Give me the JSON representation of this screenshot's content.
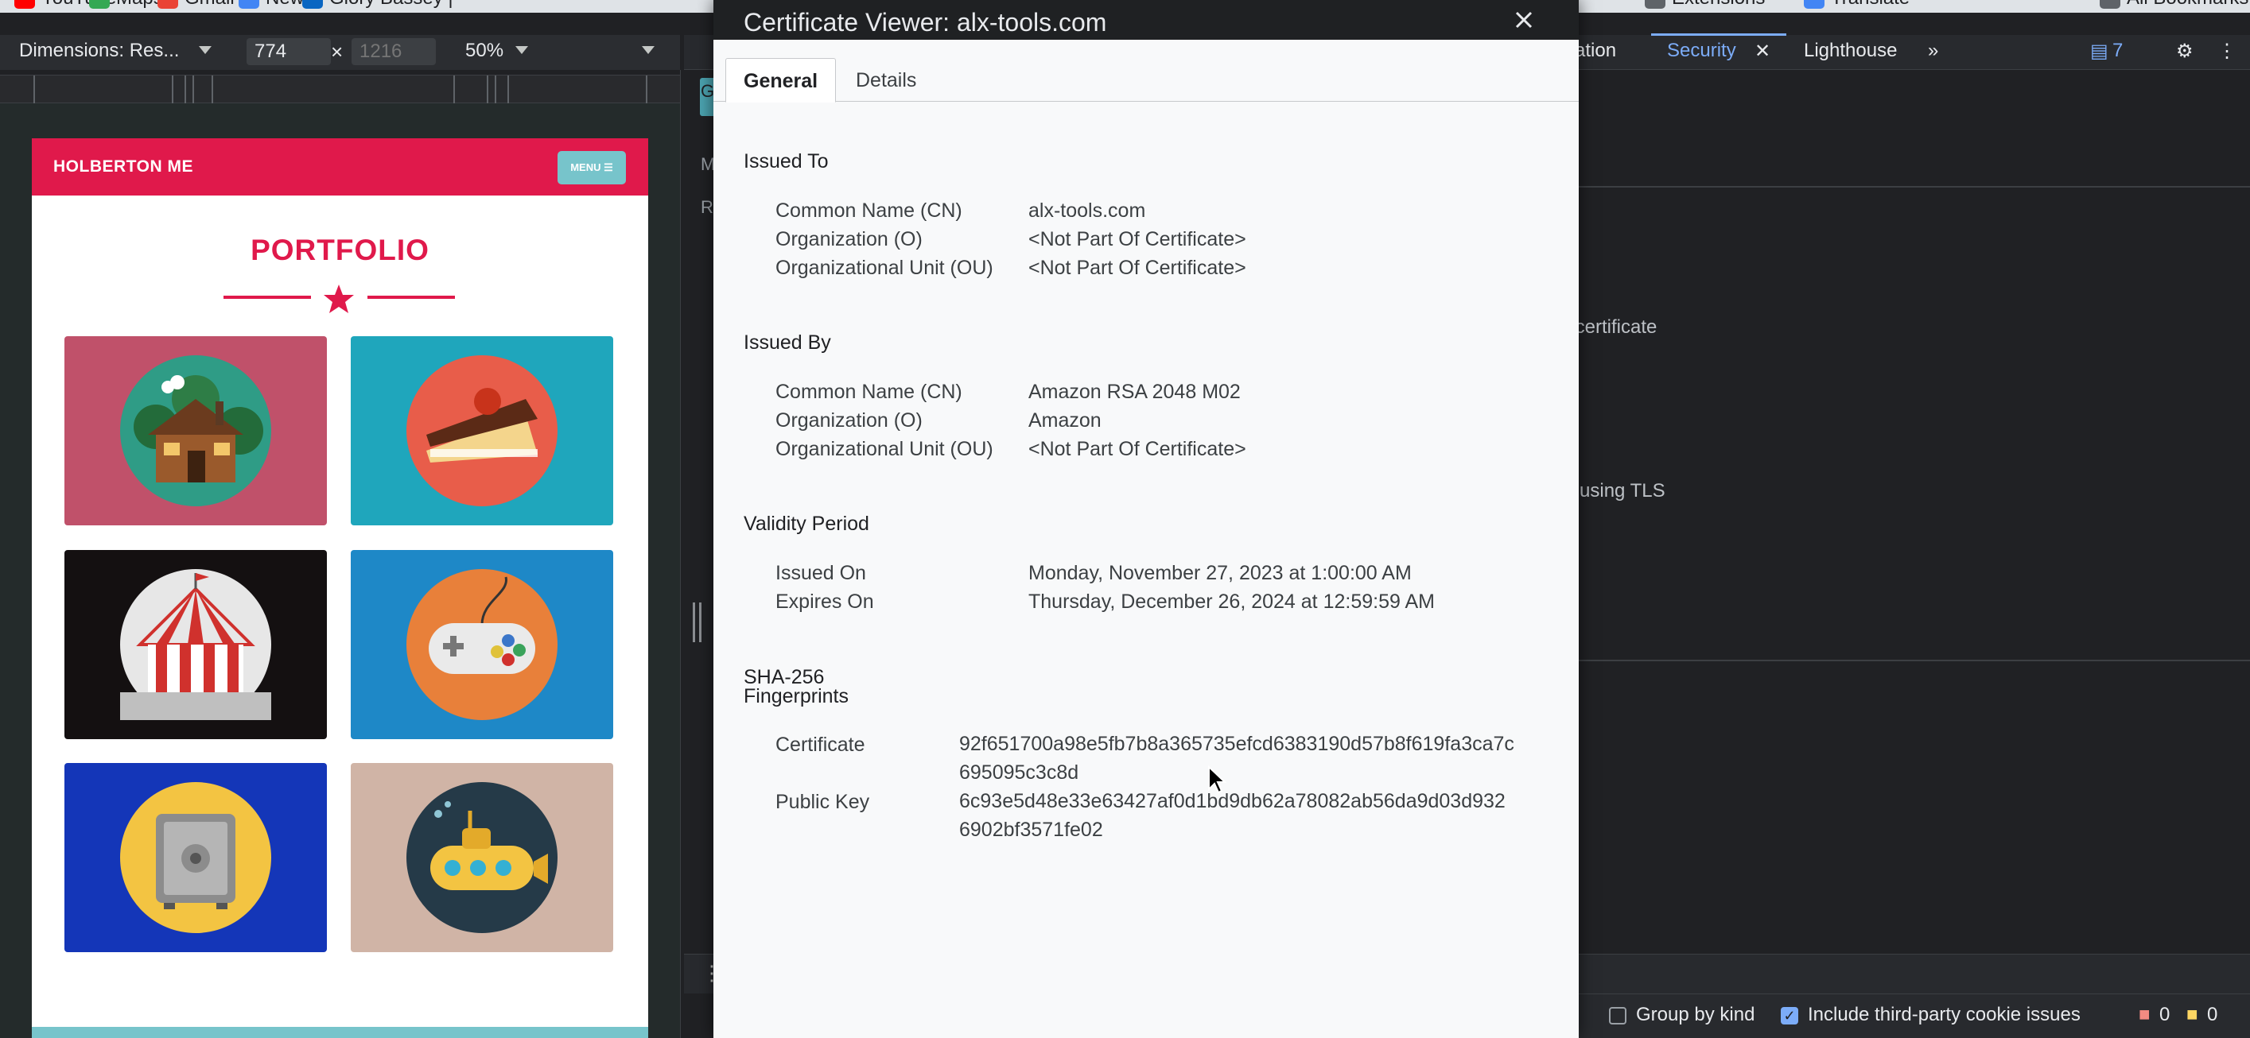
{
  "bookmarks": [
    {
      "label": "YouTube",
      "color": "#ff0000"
    },
    {
      "label": "Maps",
      "color": "#34a853"
    },
    {
      "label": "Gmail",
      "color": "#ea4335"
    },
    {
      "label": "News",
      "color": "#4285f4"
    },
    {
      "label": "Glory Bassey |",
      "color": "#0a66c2"
    },
    {
      "label": "Extensions",
      "color": "#5f6368"
    },
    {
      "label": "Translate",
      "color": "#4285f4"
    },
    {
      "label": "All Bookmarks",
      "color": "#5f6368"
    }
  ],
  "device_toolbar": {
    "dimensions_label": "Dimensions: Res...",
    "width_value": "774",
    "height_placeholder": "1216",
    "times": "×",
    "zoom": "50%"
  },
  "website": {
    "brand": "HOLBERTON ME",
    "menu_label": "MENU ☰",
    "title": "PORTFOLIO",
    "cards": [
      {
        "name": "cabin",
        "bg": "#c0516a"
      },
      {
        "name": "cake",
        "bg": "#1fa6bc"
      },
      {
        "name": "circus",
        "bg": "#141011"
      },
      {
        "name": "gamepad",
        "bg": "#1e88c7"
      },
      {
        "name": "safe",
        "bg": "#1436b8"
      },
      {
        "name": "submarine",
        "bg": "#d0b4a6"
      }
    ],
    "accent": "#e0194b"
  },
  "devtools": {
    "tabs": [
      "cation",
      "Security",
      "Lighthouse"
    ],
    "overflow": "»",
    "issues_count": "7",
    "security_fragments": [
      "r certificate",
      "d using TLS"
    ],
    "left_fragments": [
      "G",
      "M",
      "R"
    ],
    "issues_bar": {
      "group_by_kind": "Group by kind",
      "third_party": "Include third-party cookie issues",
      "errors": "0",
      "warnings": "0"
    }
  },
  "certificate": {
    "title": "Certificate Viewer: alx-tools.com",
    "tabs": [
      "General",
      "Details"
    ],
    "issued_to": {
      "heading": "Issued To",
      "rows": [
        {
          "label": "Common Name (CN)",
          "value": "alx-tools.com"
        },
        {
          "label": "Organization (O)",
          "value": "<Not Part Of Certificate>"
        },
        {
          "label": "Organizational Unit (OU)",
          "value": "<Not Part Of Certificate>"
        }
      ]
    },
    "issued_by": {
      "heading": "Issued By",
      "rows": [
        {
          "label": "Common Name (CN)",
          "value": "Amazon RSA 2048 M02"
        },
        {
          "label": "Organization (O)",
          "value": "Amazon"
        },
        {
          "label": "Organizational Unit (OU)",
          "value": "<Not Part Of Certificate>"
        }
      ]
    },
    "validity": {
      "heading": "Validity Period",
      "rows": [
        {
          "label": "Issued On",
          "value": "Monday, November 27, 2023 at 1:00:00 AM"
        },
        {
          "label": "Expires On",
          "value": "Thursday, December 26, 2024 at 12:59:59 AM"
        }
      ]
    },
    "fingerprints": {
      "heading_line1": "SHA-256",
      "heading_line2": "Fingerprints",
      "rows": [
        {
          "label": "Certificate",
          "value_line1": "92f651700a98e5fb7b8a365735efcd6383190d57b8f619fa3ca7c",
          "value_line2": "695095c3c8d"
        },
        {
          "label": "Public Key",
          "value_line1": "6c93e5d48e33e63427af0d1bd9db62a78082ab56da9d03d932",
          "value_line2": "6902bf3571fe02"
        }
      ]
    }
  }
}
